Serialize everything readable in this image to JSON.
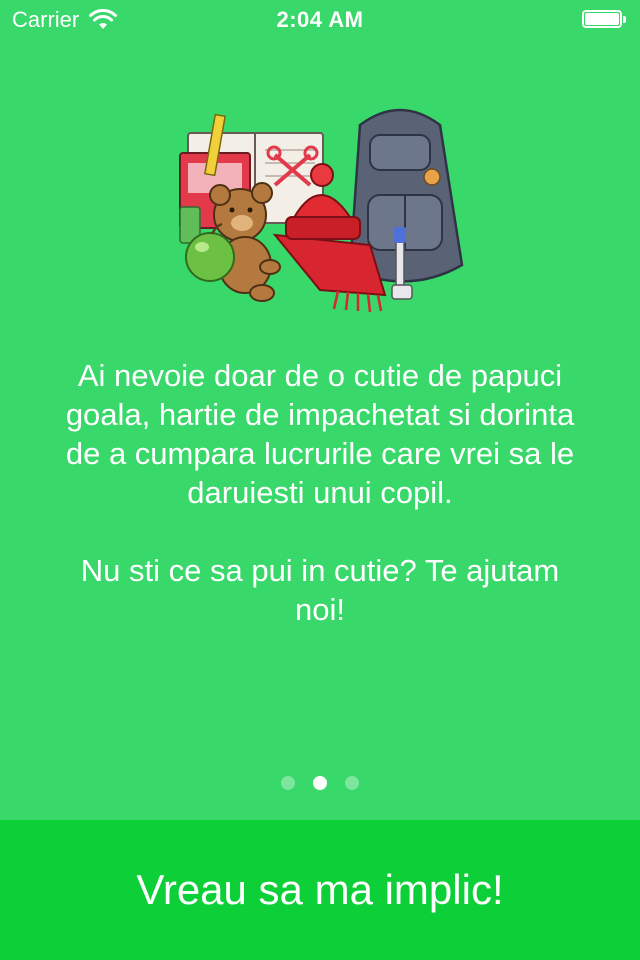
{
  "status_bar": {
    "carrier": "Carrier",
    "time": "2:04 AM",
    "wifi_icon": "wifi-icon",
    "battery_icon": "battery-full-icon"
  },
  "hero": {
    "icon": "school-supplies-illustration",
    "items": [
      "books",
      "teddy-bear",
      "green-apple",
      "red-hat",
      "red-scarf",
      "backpack",
      "toothbrush"
    ]
  },
  "message": {
    "paragraph_1": "Ai nevoie doar de o cutie de papuci goala, hartie de impachetat si dorinta de a cumpara lucrurile care vrei sa le daruiesti unui copil.",
    "paragraph_2": "Nu sti ce sa pui in cutie? Te ajutam noi!"
  },
  "pager": {
    "page_count": 3,
    "current_page": 2
  },
  "cta": {
    "label": "Vreau sa ma implic!"
  },
  "colors": {
    "background": "#39d86a",
    "cta_background": "#0dcf38",
    "text": "#ffffff"
  }
}
